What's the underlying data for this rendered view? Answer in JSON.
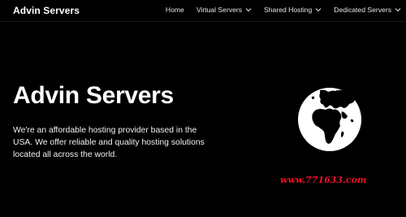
{
  "header": {
    "brand": "Advin Servers",
    "nav": [
      {
        "label": "Home",
        "has_dropdown": false
      },
      {
        "label": "Virtual Servers",
        "has_dropdown": true
      },
      {
        "label": "Shared Hosting",
        "has_dropdown": true
      },
      {
        "label": "Dedicated Servers",
        "has_dropdown": true
      }
    ]
  },
  "hero": {
    "title": "Advin Servers",
    "description": "We're an affordable hosting provider based in the USA. We offer reliable and quality hosting solutions located all across the world.",
    "icon": "globe-icon"
  },
  "watermark": "www.771633.com",
  "colors": {
    "background": "#000000",
    "text": "#ffffff",
    "watermark": "#e8102a"
  }
}
